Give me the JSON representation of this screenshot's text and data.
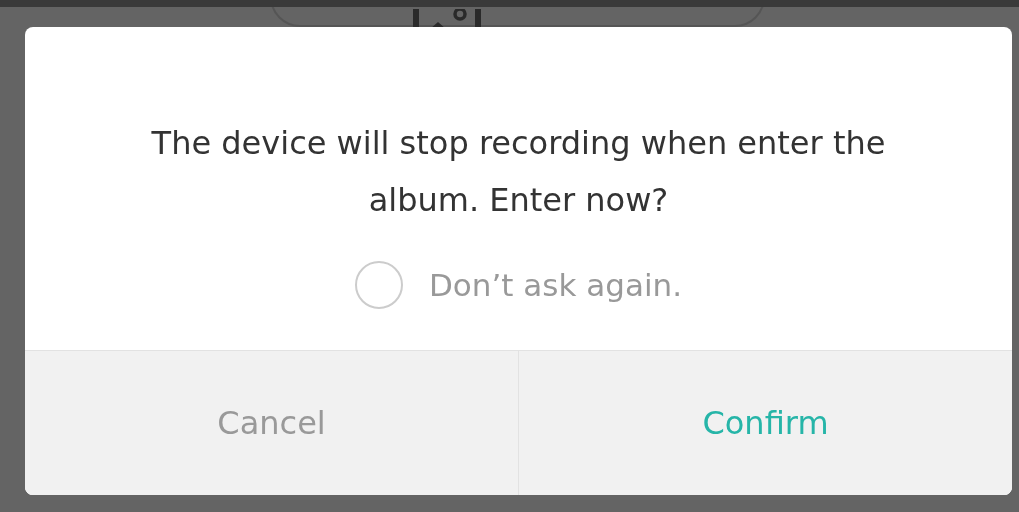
{
  "dialog": {
    "message": "The device will stop recording when enter the album. Enter now?",
    "dont_ask_again": {
      "label": "Don’t ask again.",
      "checked": false
    },
    "buttons": [
      {
        "label": "Cancel",
        "kind": "secondary"
      },
      {
        "label": "Confirm",
        "kind": "primary"
      }
    ]
  }
}
